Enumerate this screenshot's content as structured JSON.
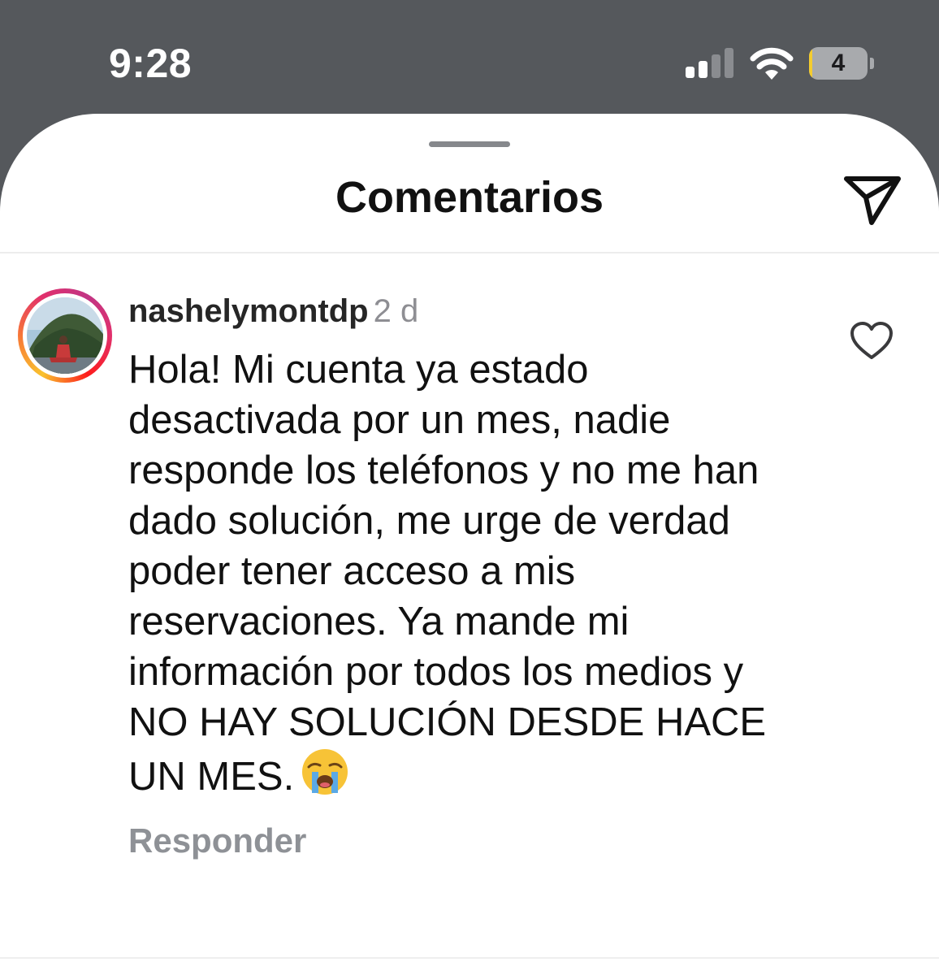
{
  "status_bar": {
    "time": "9:28",
    "signal_icon": "cellular-signal-icon",
    "wifi_icon": "wifi-icon",
    "battery_level": "4",
    "battery_fraction": 0.04
  },
  "header": {
    "title": "Comentarios",
    "share_icon": "paper-plane-icon"
  },
  "comment": {
    "username": "nashelymontdp",
    "timestamp": "2 d",
    "text": "Hola! Mi cuenta ya estado desactivada por un mes, nadie responde los teléfonos y no me han dado solución, me urge de verdad poder tener acceso a mis reservaciones. Ya mande mi información por todos los medios y NO HAY SOLUCIÓN DESDE HACE UN MES.",
    "emoji": "😭",
    "reply_label": "Responder",
    "like_icon": "heart-outline-icon"
  },
  "colors": {
    "status_bar_bg": "#55585c",
    "sheet_bg": "#ffffff",
    "secondary_text": "#8e8e93",
    "battery_low": "#f4cc2e"
  }
}
